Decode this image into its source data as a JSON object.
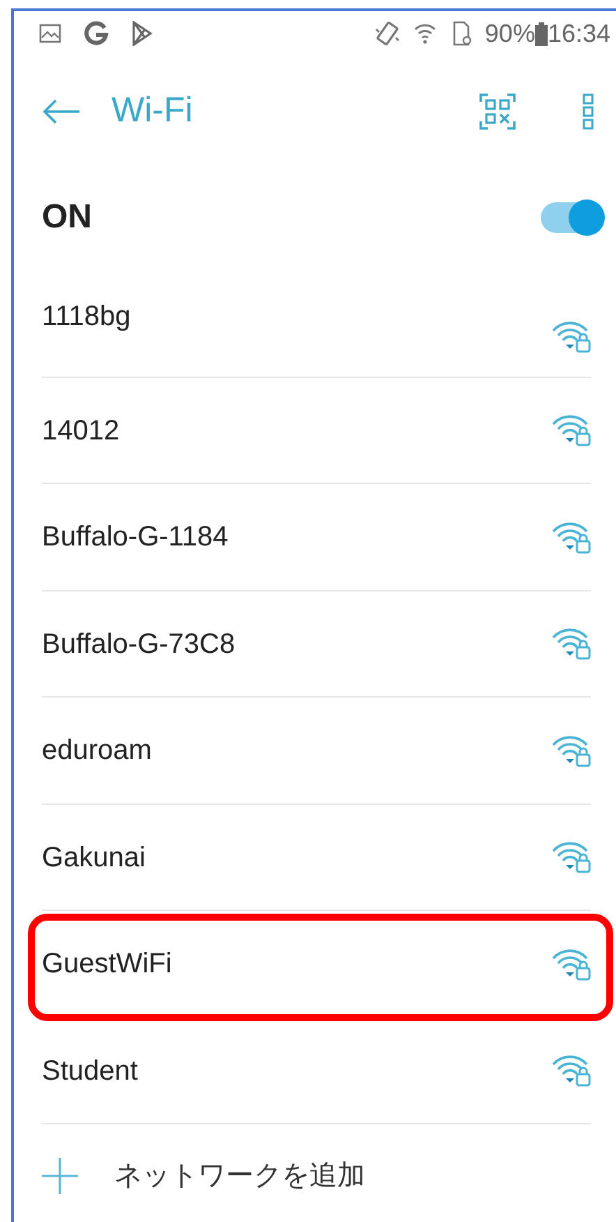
{
  "status_bar": {
    "battery": "90%",
    "time": "16:34"
  },
  "toolbar": {
    "title": "Wi-Fi"
  },
  "wifi_switch": {
    "label": "ON",
    "on": true
  },
  "networks": [
    {
      "name": "1118bg",
      "highlighted": false
    },
    {
      "name": "14012",
      "highlighted": false
    },
    {
      "name": "Buffalo-G-1184",
      "highlighted": false
    },
    {
      "name": "Buffalo-G-73C8",
      "highlighted": false
    },
    {
      "name": "eduroam",
      "highlighted": false
    },
    {
      "name": "Gakunai",
      "highlighted": false
    },
    {
      "name": "GuestWiFi",
      "highlighted": true
    },
    {
      "name": "Student",
      "highlighted": false
    }
  ],
  "add_network": {
    "label": "ネットワークを追加"
  }
}
